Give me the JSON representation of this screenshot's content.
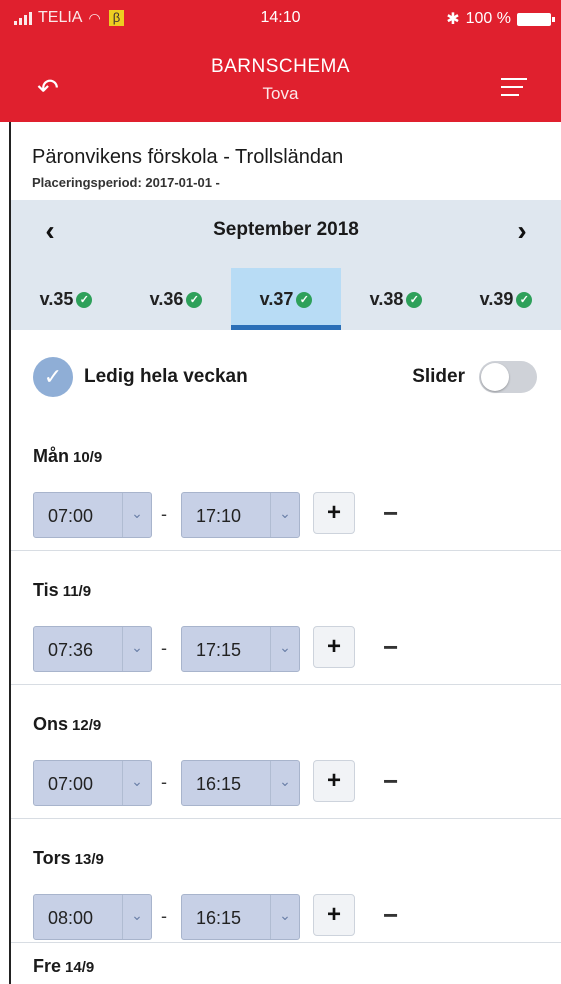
{
  "status_bar": {
    "carrier": "TELIA",
    "beta": "β",
    "time": "14:10",
    "battery": "100 %"
  },
  "header": {
    "title": "BARNSCHEMA",
    "subtitle": "Tova"
  },
  "school": {
    "name": "Päronvikens förskola - Trollsländan",
    "period": "Placeringsperiod: 2017-01-01 -"
  },
  "calendar": {
    "month": "September 2018",
    "prev": "‹",
    "next": "›",
    "weeks": [
      {
        "label": "v.35",
        "done": true
      },
      {
        "label": "v.36",
        "done": true
      },
      {
        "label": "v.37",
        "done": true,
        "active": true
      },
      {
        "label": "v.38",
        "done": true
      },
      {
        "label": "v.39",
        "done": true
      }
    ]
  },
  "options": {
    "ledig_label": "Ledig hela veckan",
    "ledig_checked": true,
    "slider_label": "Slider",
    "slider_on": false
  },
  "days": [
    {
      "name": "Mån",
      "date": "10/9",
      "from": "07:00",
      "to": "17:10",
      "plus": "+",
      "minus": "−",
      "sep": "-"
    },
    {
      "name": "Tis",
      "date": "11/9",
      "from": "07:36",
      "to": "17:15",
      "plus": "+",
      "minus": "−",
      "sep": "-"
    },
    {
      "name": "Ons",
      "date": "12/9",
      "from": "07:00",
      "to": "16:15",
      "plus": "+",
      "minus": "−",
      "sep": "-"
    },
    {
      "name": "Tors",
      "date": "13/9",
      "from": "08:00",
      "to": "16:15",
      "plus": "+",
      "minus": "−",
      "sep": "-"
    },
    {
      "name": "Fre",
      "date": "14/9"
    }
  ],
  "colors": {
    "header": "#e0202e",
    "active_week": "#b8dcf5",
    "week_underline": "#2a6fb7",
    "check": "#2ea05a"
  }
}
